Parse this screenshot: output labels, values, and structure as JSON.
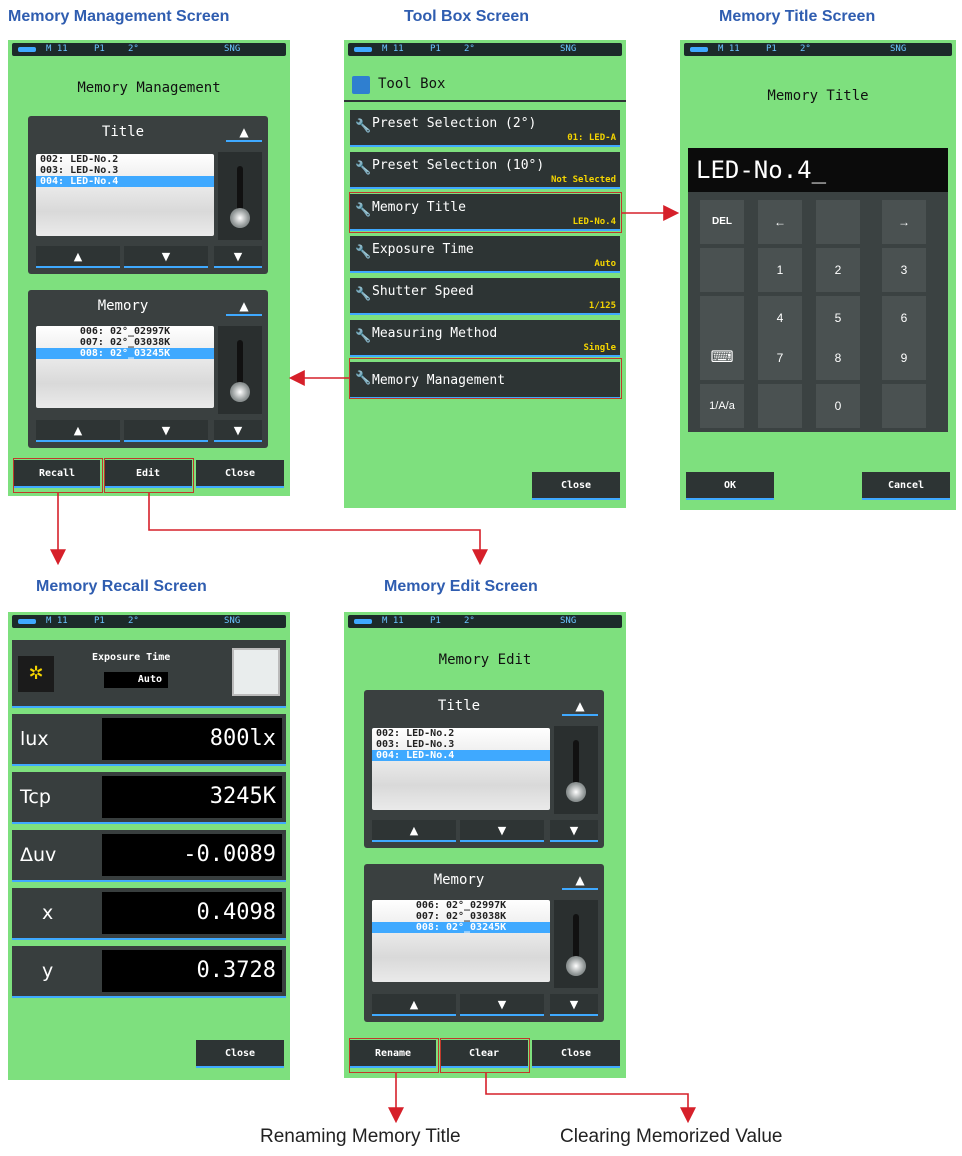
{
  "captions": {
    "memory_management": "Memory Management Screen",
    "tool_box": "Tool Box Screen",
    "memory_title": "Memory Title Screen",
    "memory_recall": "Memory Recall Screen",
    "memory_edit": "Memory Edit Screen",
    "rename_note": "Renaming Memory Title",
    "clear_note": "Clearing Memorized Value"
  },
  "status": {
    "mem": "M 11",
    "preset": "P1",
    "angle": "2°",
    "mode": "SNG"
  },
  "colors": {
    "screen_bg": "#7ee07e",
    "accent": "#3fa9ff",
    "value_yellow": "#f4d400",
    "highlight": "#c0392b",
    "caption_blue": "#2f5db0"
  },
  "memory_management": {
    "heading": "Memory Management",
    "title_panel": {
      "label": "Title",
      "rows": [
        "002: LED-No.2",
        "003: LED-No.3",
        "004: LED-No.4"
      ]
    },
    "memory_panel": {
      "label": "Memory",
      "rows": [
        "006: 02°_02997K",
        "007: 02°_03038K",
        "008: 02°_03245K"
      ]
    },
    "buttons": {
      "recall": "Recall",
      "edit": "Edit",
      "close": "Close"
    }
  },
  "tool_box": {
    "heading": "Tool Box",
    "items": [
      {
        "label": "Preset Selection (2°)",
        "value": "01: LED-A"
      },
      {
        "label": "Preset Selection (10°)",
        "value": "Not Selected"
      },
      {
        "label": "Memory Title",
        "value": "LED-No.4"
      },
      {
        "label": "Exposure Time",
        "value": "Auto"
      },
      {
        "label": "Shutter Speed",
        "value": "1/125"
      },
      {
        "label": "Measuring Method",
        "value": "Single"
      },
      {
        "label": "Memory Management",
        "value": ""
      }
    ],
    "close": "Close"
  },
  "memory_title": {
    "heading": "Memory Title",
    "input_value": "LED-No.4_",
    "keys": {
      "del": "DEL",
      "left": "←",
      "right": "→",
      "k1": "1",
      "k2": "2",
      "k3": "3",
      "k4": "4",
      "k5": "5",
      "k6": "6",
      "k7": "7",
      "k8": "8",
      "k9": "9",
      "k0": "0",
      "case": "1/A/a"
    },
    "ok": "OK",
    "cancel": "Cancel"
  },
  "memory_recall": {
    "exposure_label": "Exposure Time",
    "exposure_value": "Auto",
    "rows": [
      {
        "label": "lux",
        "value": "800lx"
      },
      {
        "label": "Tcp",
        "value": "3245K"
      },
      {
        "label": "Δuv",
        "value": "-0.0089"
      },
      {
        "label": "x",
        "value": "0.4098"
      },
      {
        "label": "y",
        "value": "0.3728"
      }
    ],
    "close": "Close"
  },
  "memory_edit": {
    "heading": "Memory Edit",
    "title_panel": {
      "label": "Title",
      "rows": [
        "002: LED-No.2",
        "003: LED-No.3",
        "004: LED-No.4"
      ]
    },
    "memory_panel": {
      "label": "Memory",
      "rows": [
        "006: 02°_02997K",
        "007: 02°_03038K",
        "008: 02°_03245K"
      ]
    },
    "buttons": {
      "rename": "Rename",
      "clear": "Clear",
      "close": "Close"
    }
  }
}
